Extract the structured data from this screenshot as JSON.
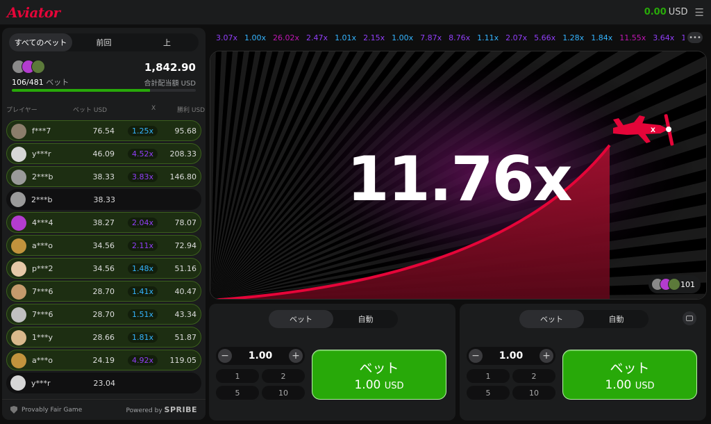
{
  "header": {
    "logo": "Aviator",
    "balance": "0.00",
    "currency": "USD",
    "menu_icon": "hamburger-icon"
  },
  "left_panel": {
    "tabs": [
      "すべてのベット",
      "前回",
      "上"
    ],
    "active_tab": 0,
    "bets_count": "106/481",
    "bets_label": "ベット",
    "total": "1,842.90",
    "total_label": "合計配当額 USD",
    "progress_fraction": 0.75,
    "columns": {
      "player": "プレイヤー",
      "bet": "ベット USD",
      "x": "X",
      "win": "勝利 USD"
    },
    "rows": [
      {
        "name": "f***7",
        "bet": "76.54",
        "mult": "1.25x",
        "win": "95.68",
        "mult_color": "#34b4ff",
        "avatar_color": "#8b7d6b"
      },
      {
        "name": "y***r",
        "bet": "46.09",
        "mult": "4.52x",
        "win": "208.33",
        "mult_color": "#913ef8",
        "avatar_color": "#d6d6d6"
      },
      {
        "name": "2***b",
        "bet": "38.33",
        "mult": "3.83x",
        "win": "146.80",
        "mult_color": "#913ef8",
        "avatar_color": "#9a9a9a"
      },
      {
        "name": "2***b",
        "bet": "38.33",
        "mult": "",
        "win": "",
        "mult_color": "",
        "avatar_color": "#9a9a9a"
      },
      {
        "name": "4***4",
        "bet": "38.27",
        "mult": "2.04x",
        "win": "78.07",
        "mult_color": "#913ef8",
        "avatar_color": "#b33ccf"
      },
      {
        "name": "a***o",
        "bet": "34.56",
        "mult": "2.11x",
        "win": "72.94",
        "mult_color": "#913ef8",
        "avatar_color": "#c2933d"
      },
      {
        "name": "p***2",
        "bet": "34.56",
        "mult": "1.48x",
        "win": "51.16",
        "mult_color": "#34b4ff",
        "avatar_color": "#e6c9a8"
      },
      {
        "name": "7***6",
        "bet": "28.70",
        "mult": "1.41x",
        "win": "40.47",
        "mult_color": "#34b4ff",
        "avatar_color": "#c49a6c"
      },
      {
        "name": "7***6",
        "bet": "28.70",
        "mult": "1.51x",
        "win": "43.34",
        "mult_color": "#34b4ff",
        "avatar_color": "#c0c0c0"
      },
      {
        "name": "1***y",
        "bet": "28.66",
        "mult": "1.81x",
        "win": "51.87",
        "mult_color": "#34b4ff",
        "avatar_color": "#d9b98c"
      },
      {
        "name": "a***o",
        "bet": "24.19",
        "mult": "4.92x",
        "win": "119.05",
        "mult_color": "#913ef8",
        "avatar_color": "#c2933d"
      },
      {
        "name": "y***r",
        "bet": "23.04",
        "mult": "",
        "win": "",
        "mult_color": "",
        "avatar_color": "#d6d6d6"
      }
    ],
    "footer_left": "Provably Fair Game",
    "footer_powered": "Powered by",
    "footer_brand": "SPRIBE"
  },
  "history": [
    {
      "v": "3.07x",
      "c": "#913ef8"
    },
    {
      "v": "1.00x",
      "c": "#34b4ff"
    },
    {
      "v": "26.02x",
      "c": "#c017b4"
    },
    {
      "v": "2.47x",
      "c": "#913ef8"
    },
    {
      "v": "1.01x",
      "c": "#34b4ff"
    },
    {
      "v": "2.15x",
      "c": "#913ef8"
    },
    {
      "v": "1.00x",
      "c": "#34b4ff"
    },
    {
      "v": "7.87x",
      "c": "#913ef8"
    },
    {
      "v": "8.76x",
      "c": "#913ef8"
    },
    {
      "v": "1.11x",
      "c": "#34b4ff"
    },
    {
      "v": "2.07x",
      "c": "#913ef8"
    },
    {
      "v": "5.66x",
      "c": "#913ef8"
    },
    {
      "v": "1.28x",
      "c": "#34b4ff"
    },
    {
      "v": "1.84x",
      "c": "#34b4ff"
    },
    {
      "v": "11.55x",
      "c": "#c017b4"
    },
    {
      "v": "3.64x",
      "c": "#913ef8"
    },
    {
      "v": "1",
      "c": "#913ef8"
    }
  ],
  "game": {
    "multiplier": "11.76x",
    "players_online": "101",
    "plane_icon": "airplane-icon"
  },
  "bet_panels": [
    {
      "tabs": [
        "ベット",
        "自動"
      ],
      "amount": "1.00",
      "quick": [
        "1",
        "2",
        "5",
        "10"
      ],
      "button_label": "ベット",
      "button_amount": "1.00",
      "button_currency": "USD"
    },
    {
      "tabs": [
        "ベット",
        "自動"
      ],
      "amount": "1.00",
      "quick": [
        "1",
        "2",
        "5",
        "10"
      ],
      "button_label": "ベット",
      "button_amount": "1.00",
      "button_currency": "USD"
    }
  ],
  "colors": {
    "accent_red": "#e50539",
    "green": "#28a909",
    "blue_mult": "#34b4ff",
    "purple_mult": "#913ef8",
    "pink_mult": "#c017b4"
  }
}
